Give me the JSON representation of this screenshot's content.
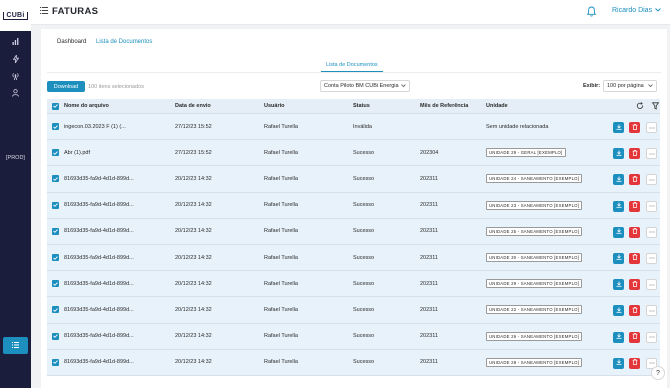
{
  "app": {
    "logo_text": "CUBi",
    "page_title": "FATURAS",
    "user_name": "Ricardo Dias",
    "env_label": "[PROD]"
  },
  "tabs": [
    {
      "label": "Dashboard",
      "active": true
    },
    {
      "label": "Lista de Documentos",
      "active": false
    }
  ],
  "subtab": {
    "label": "Lista de Documentos"
  },
  "toolbar": {
    "download_label": "Download",
    "selected_text": "100 itens selecionados",
    "account_value": "Conta Piloto BM CUBi Energia",
    "exibir_label": "Exibir:",
    "per_page_value": "100 por página"
  },
  "table": {
    "columns": [
      "Nome do arquivo",
      "Data de envio",
      "Usuário",
      "Status",
      "Mês de Referência",
      "Unidade"
    ],
    "rows": [
      {
        "name": "ingecon.03.2023 F (1) (...",
        "date": "27/12/23 15:52",
        "user": "Rafael Turella",
        "status": "Inválida",
        "ref": "",
        "unit": "Sem unidade relacionada",
        "unit_badge": false
      },
      {
        "name": "Abr (1).pdf",
        "date": "27/12/23 15:52",
        "user": "Rafael Turella",
        "status": "Sucesso",
        "ref": "202304",
        "unit": "UNIDADE 29 - GERAL [EXEMPLO]",
        "unit_badge": true
      },
      {
        "name": "81693d35-fa9d-4d1d-899d...",
        "date": "20/12/23 14:32",
        "user": "Rafael Turella",
        "status": "Sucesso",
        "ref": "202311",
        "unit": "UNIDADE 24 - SANEAMENTO [EXEMPLO]",
        "unit_badge": true
      },
      {
        "name": "81693d35-fa9d-4d1d-899d...",
        "date": "20/12/23 14:32",
        "user": "Rafael Turella",
        "status": "Sucesso",
        "ref": "202311",
        "unit": "UNIDADE 23 - SANEAMENTO [EXEMPLO]",
        "unit_badge": true
      },
      {
        "name": "81693d35-fa9d-4d1d-899d...",
        "date": "20/12/23 14:32",
        "user": "Rafael Turella",
        "status": "Sucesso",
        "ref": "202311",
        "unit": "UNIDADE 25 - SANEAMENTO [EXEMPLO]",
        "unit_badge": true
      },
      {
        "name": "81693d35-fa9d-4d1d-899d...",
        "date": "20/12/23 14:32",
        "user": "Rafael Turella",
        "status": "Sucesso",
        "ref": "202311",
        "unit": "UNIDADE 30 - SANEAMENTO [EXEMPLO]",
        "unit_badge": true
      },
      {
        "name": "81693d35-fa9d-4d1d-899d...",
        "date": "20/12/23 14:32",
        "user": "Rafael Turella",
        "status": "Sucesso",
        "ref": "202311",
        "unit": "UNIDADE 29 - SANEAMENTO [EXEMPLO]",
        "unit_badge": true
      },
      {
        "name": "81693d35-fa9d-4d1d-899d...",
        "date": "20/12/23 14:32",
        "user": "Rafael Turella",
        "status": "Sucesso",
        "ref": "202311",
        "unit": "UNIDADE 22 - SANEAMENTO [EXEMPLO]",
        "unit_badge": true
      },
      {
        "name": "81693d35-fa9d-4d1d-899d...",
        "date": "20/12/23 14:32",
        "user": "Rafael Turella",
        "status": "Sucesso",
        "ref": "202311",
        "unit": "UNIDADE 26 - SANEAMENTO [EXEMPLO]",
        "unit_badge": true
      },
      {
        "name": "81693d35-fa9d-4d1d-899d...",
        "date": "20/12/23 14:32",
        "user": "Rafael Turella",
        "status": "Sucesso",
        "ref": "202311",
        "unit": "UNIDADE 28 - SANEAMENTO [EXEMPLO]",
        "unit_badge": true
      }
    ]
  },
  "help": {
    "label": "?"
  },
  "colors": {
    "sidebar_bg": "#1a1d3b",
    "accent": "#1d8fbf",
    "danger": "#e2363b",
    "row_selected_bg": "#e8f2fa"
  },
  "icons": {
    "sidebar": [
      "bar-chart-icon",
      "bolt-icon",
      "broadcast-icon",
      "user-icon",
      "menu-collapse-icon"
    ],
    "header": [
      "hamburger-icon",
      "bell-icon",
      "chevron-down-icon"
    ],
    "row_actions": [
      "download-icon",
      "trash-icon",
      "more-icon"
    ],
    "table_header": [
      "refresh-icon",
      "filter-icon"
    ]
  }
}
